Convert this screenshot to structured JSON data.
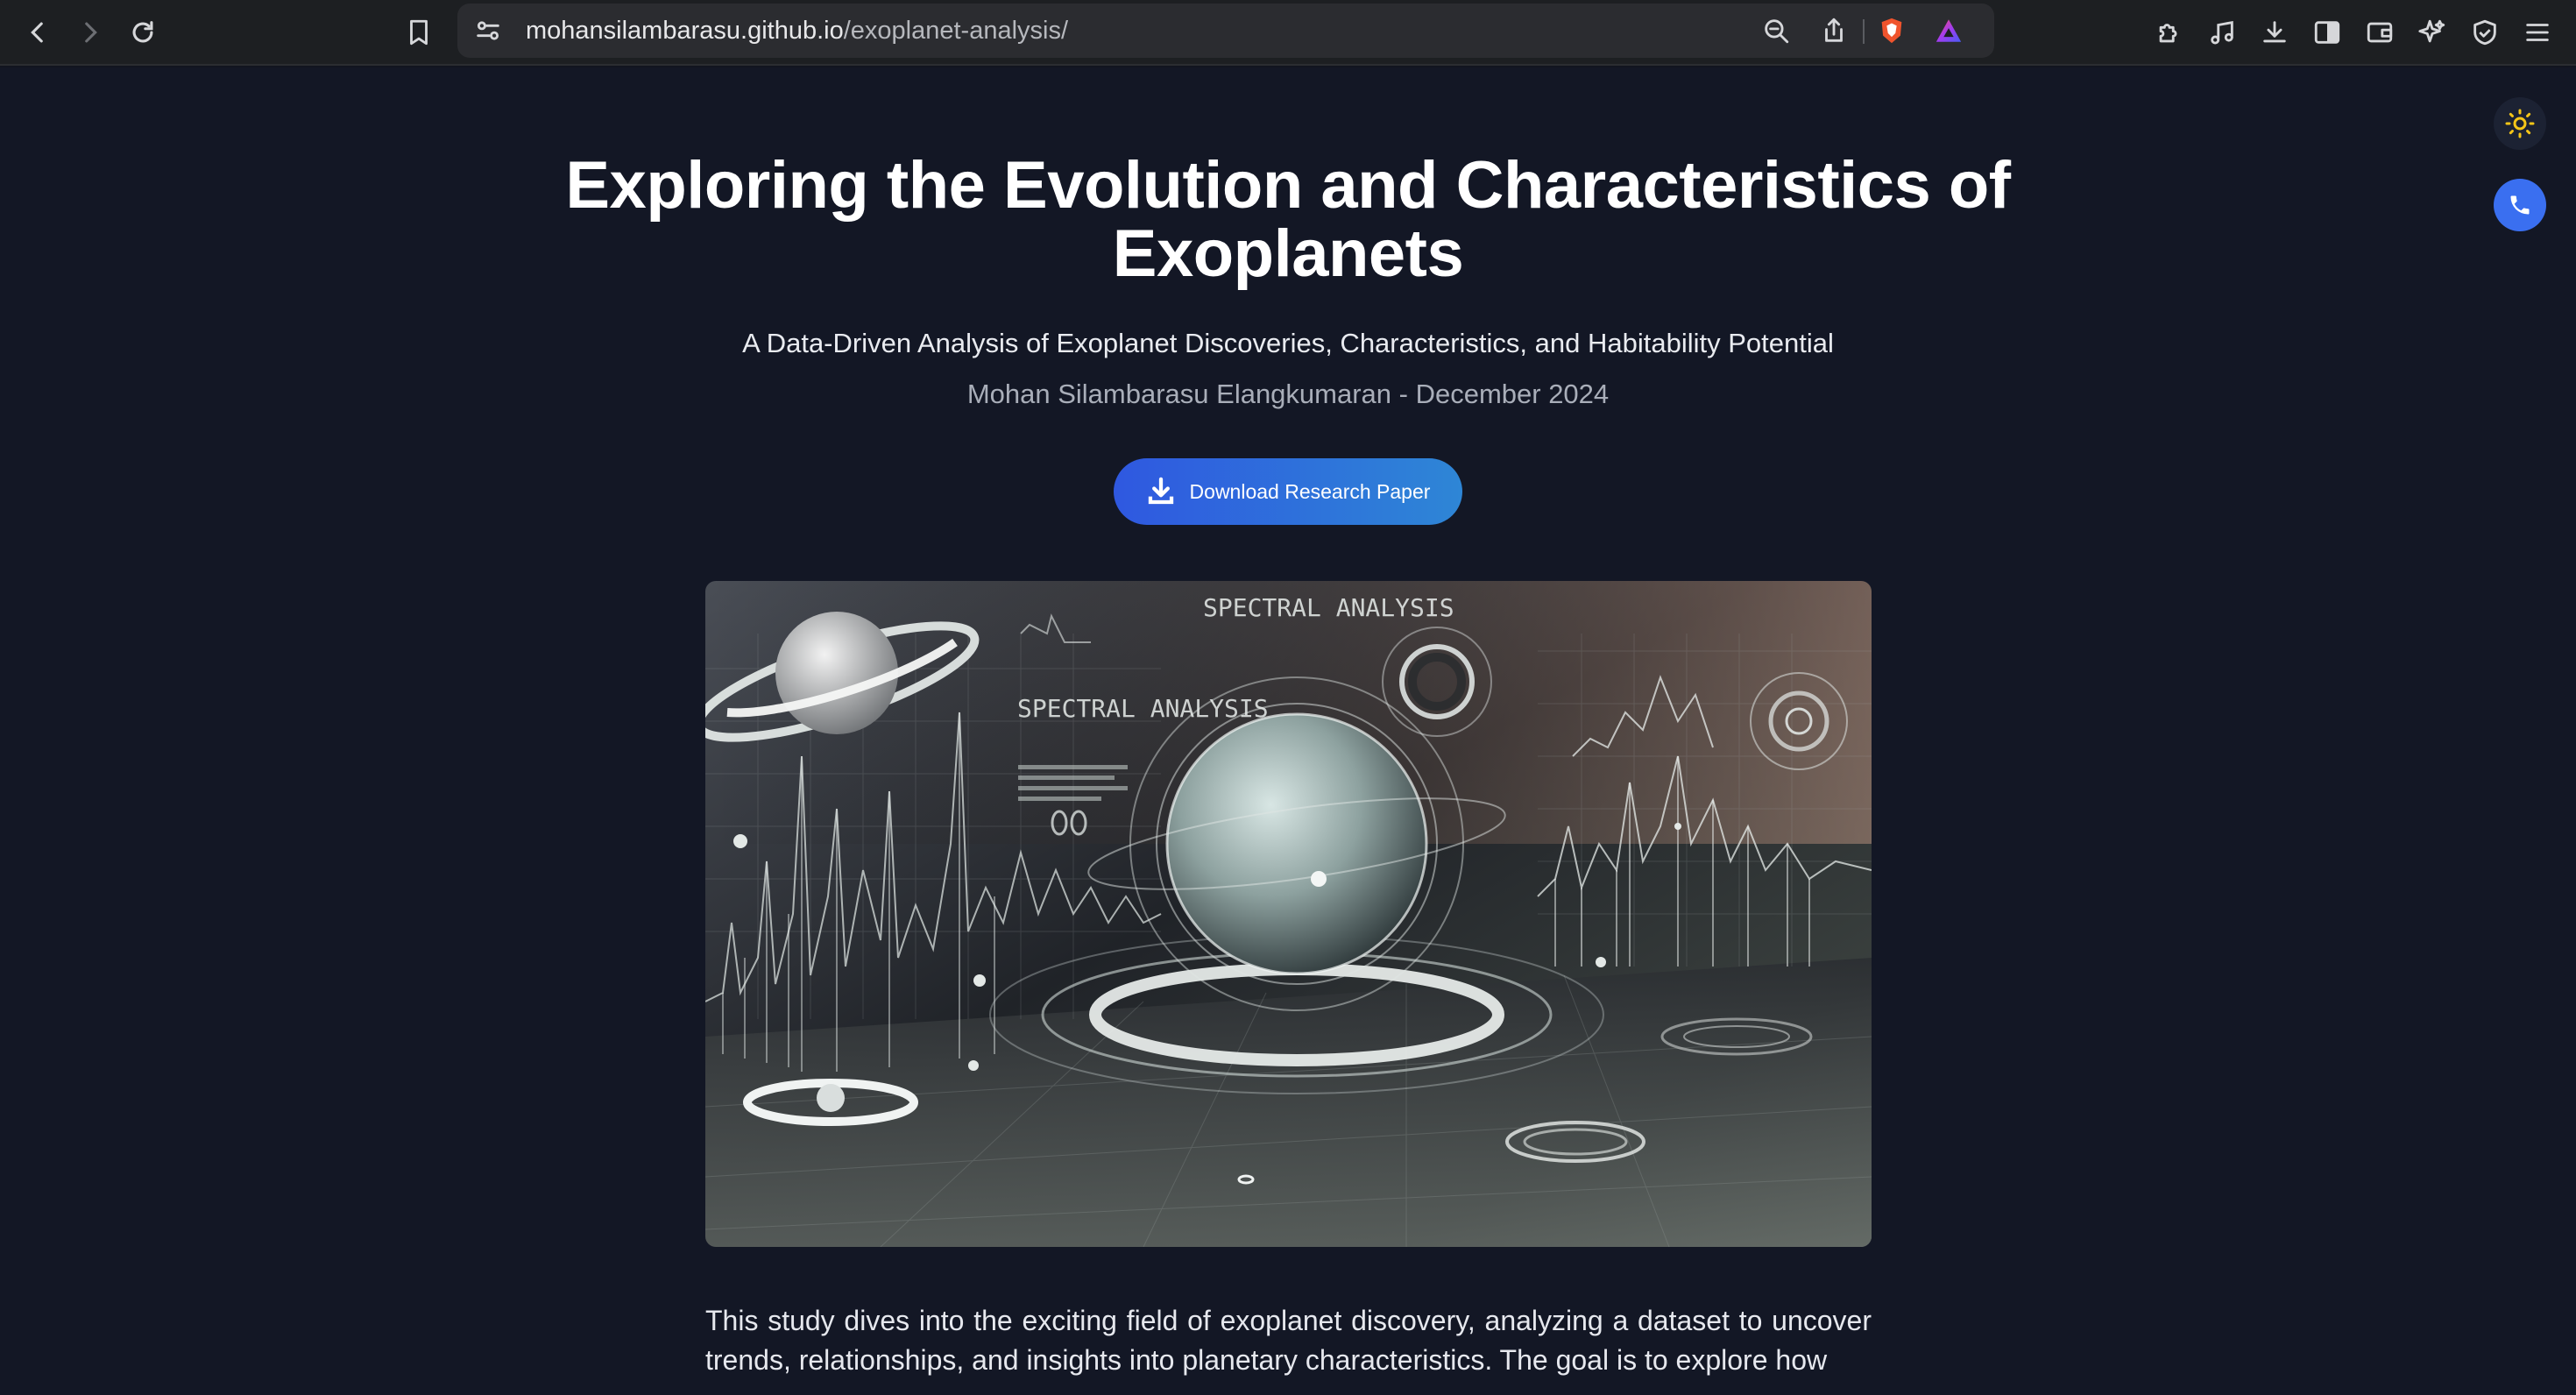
{
  "browser": {
    "url_host": "mohansilambarasu.github.io",
    "url_path": "/exoplanet-analysis/",
    "icons": {
      "back": "back-arrow-icon",
      "forward": "forward-arrow-icon",
      "reload": "reload-icon",
      "bookmark": "bookmark-icon",
      "site_settings": "site-settings-icon",
      "zoom": "zoom-icon",
      "share": "share-icon",
      "brave_shields": "brave-shield-icon",
      "brave_rewards": "brave-rewards-icon",
      "extensions": "extensions-icon",
      "media": "music-note-icon",
      "downloads": "download-icon",
      "sidebar": "sidebar-icon",
      "wallet": "wallet-icon",
      "leo": "ai-sparkle-icon",
      "vpn": "vpn-shield-icon",
      "menu": "hamburger-menu-icon"
    }
  },
  "page": {
    "title": "Exploring the Evolution and Characteristics of Exoplanets",
    "subtitle": "A Data-Driven Analysis of Exoplanet Discoveries, Characteristics, and Habitability Potential",
    "author": "Mohan Silambarasu Elangkumaran - December 2024",
    "download_label": "Download Research Paper",
    "hero_labels": {
      "top": "SPECTRAL ANALYSIS",
      "left": "SPECTRAL ANALYSIS"
    },
    "intro": "This study dives into the exciting field of exoplanet discovery, analyzing a dataset to uncover trends, relationships, and insights into planetary characteristics. The goal is to explore how"
  },
  "colors": {
    "background": "#131725",
    "accent": "#3a6ff0",
    "button_gradient_start": "#2f58e0",
    "button_gradient_end": "#2e86d6",
    "theme_icon": "#f5c518"
  }
}
